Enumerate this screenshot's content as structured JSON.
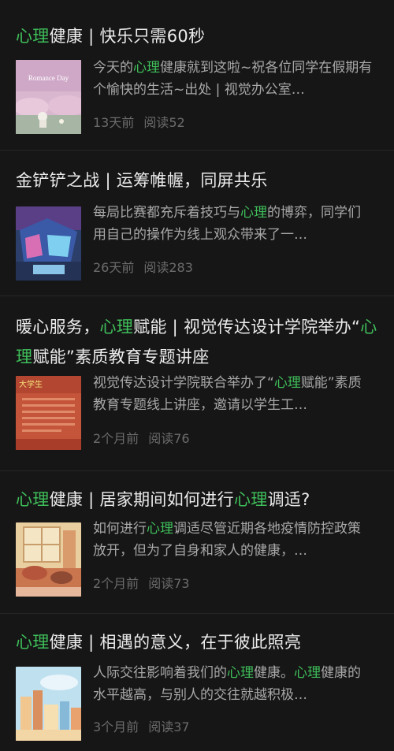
{
  "articles": [
    {
      "title_parts": [
        {
          "t": "心理",
          "hl": true
        },
        {
          "t": "健康 | 快乐只需60秒",
          "hl": false
        }
      ],
      "summary_parts": [
        {
          "t": "今天的",
          "hl": false
        },
        {
          "t": "心理",
          "hl": true
        },
        {
          "t": "健康就到这啦~祝各位同学在假期有个愉快的生活~出处 | 视觉办公室…",
          "hl": false
        }
      ],
      "time": "13天前",
      "reads": "阅读52",
      "thumb_text": "Romance Day"
    },
    {
      "title_parts": [
        {
          "t": "金铲铲之战 | 运筹帷幄，同屏共乐",
          "hl": false
        }
      ],
      "summary_parts": [
        {
          "t": "每局比赛都充斥着技巧与",
          "hl": false
        },
        {
          "t": "心理",
          "hl": true
        },
        {
          "t": "的博弈，同学们用自己的操作为线上观众带来了一…",
          "hl": false
        }
      ],
      "time": "26天前",
      "reads": "阅读283",
      "thumb_text": ""
    },
    {
      "title_parts": [
        {
          "t": "暖心服务，",
          "hl": false
        },
        {
          "t": "心理",
          "hl": true
        },
        {
          "t": "赋能 | 视觉传达设计学院举办“",
          "hl": false
        },
        {
          "t": "心理",
          "hl": true
        },
        {
          "t": "赋能”素质教育专题讲座",
          "hl": false
        }
      ],
      "summary_parts": [
        {
          "t": "视觉传达设计学院联合举办了“",
          "hl": false
        },
        {
          "t": "心理",
          "hl": true
        },
        {
          "t": "赋能”素质教育专题线上讲座，邀请以学生工…",
          "hl": false
        }
      ],
      "time": "2个月前",
      "reads": "阅读76",
      "thumb_text": "大学生"
    },
    {
      "title_parts": [
        {
          "t": "心理",
          "hl": true
        },
        {
          "t": "健康 | 居家期间如何进行",
          "hl": false
        },
        {
          "t": "心理",
          "hl": true
        },
        {
          "t": "调适?",
          "hl": false
        }
      ],
      "summary_parts": [
        {
          "t": "如何进行",
          "hl": false
        },
        {
          "t": "心理",
          "hl": true
        },
        {
          "t": "调适尽管近期各地疫情防控政策放开，但为了自身和家人的健康，…",
          "hl": false
        }
      ],
      "time": "2个月前",
      "reads": "阅读73",
      "thumb_text": ""
    },
    {
      "title_parts": [
        {
          "t": "心理",
          "hl": true
        },
        {
          "t": "健康 | 相遇的意义，在于彼此照亮",
          "hl": false
        }
      ],
      "summary_parts": [
        {
          "t": "人际交往影响着我们的",
          "hl": false
        },
        {
          "t": "心理",
          "hl": true
        },
        {
          "t": "健康。",
          "hl": false
        },
        {
          "t": "心理",
          "hl": true
        },
        {
          "t": "健康的水平越高，与别人的交往就越积极…",
          "hl": false
        }
      ],
      "time": "3个月前",
      "reads": "阅读37",
      "thumb_text": ""
    }
  ]
}
